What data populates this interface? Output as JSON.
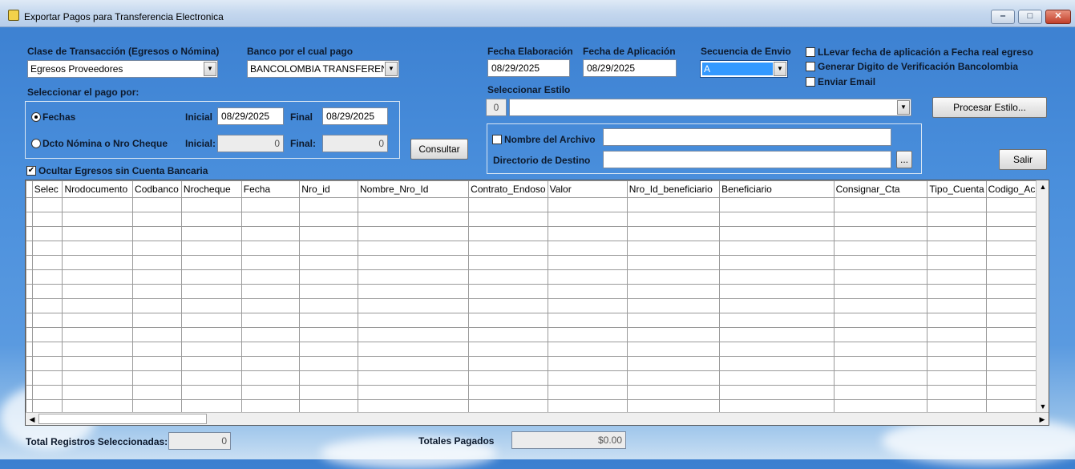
{
  "window": {
    "title": "Exportar Pagos para Transferencia Electronica",
    "min": "‒",
    "max": "□",
    "close": "✕"
  },
  "clase": {
    "label": "Clase de Transacción (Egresos o Nómina)",
    "value": "Egresos Proveedores"
  },
  "banco": {
    "label": "Banco por el cual pago",
    "value": "BANCOLOMBIA TRANSFERENCIA"
  },
  "seleccionar_pago": {
    "label": "Seleccionar el pago por:",
    "fechas_label": "Fechas",
    "inicial_label": "Inicial",
    "inicial_value": "08/29/2025",
    "final_label": "Final",
    "final_value": "08/29/2025",
    "dcto_label": "Dcto Nómina o Nro Cheque",
    "inicial2_label": "Inicial:",
    "inicial2_value": "0",
    "final2_label": "Final:",
    "final2_value": "0"
  },
  "consultar": "Consultar",
  "ocultar": "Ocultar Egresos sin Cuenta Bancaria",
  "fecha_elab": {
    "label": "Fecha Elaboración",
    "value": "08/29/2025"
  },
  "fecha_apl": {
    "label": "Fecha de Aplicación",
    "value": "08/29/2025"
  },
  "secuencia": {
    "label": "Secuencia de Envio",
    "value": "A"
  },
  "options": {
    "llevar": "LLevar fecha de aplicación a Fecha real egreso",
    "generar": "Generar Digito de Verificación Bancolombia",
    "enviar": "Enviar Email"
  },
  "estilo": {
    "label": "Seleccionar Estilo",
    "num": "0",
    "value": "",
    "procesar": "Procesar Estilo..."
  },
  "archivo": {
    "nombre_label": "Nombre del Archivo",
    "nombre_value": "",
    "dir_label": "Directorio de Destino",
    "dir_value": "",
    "browse": "..."
  },
  "salir": "Salir",
  "grid": {
    "columns": [
      "Selec",
      "Nrodocumento",
      "Codbanco",
      "Nrocheque",
      "Fecha",
      "Nro_id",
      "Nombre_Nro_Id",
      "Contrato_Endoso",
      "Valor",
      "Nro_Id_beneficiario",
      "Beneficiario",
      "Consignar_Cta",
      "Tipo_Cuenta",
      "Codigo_Ach"
    ]
  },
  "footer": {
    "total_label": "Total Registros Seleccionadas:",
    "total_value": "0",
    "totales_label": "Totales Pagados",
    "totales_value": "$0.00"
  },
  "colors": {
    "accent": "#2f6fc2",
    "sequence_highlight": "#3399ff"
  }
}
